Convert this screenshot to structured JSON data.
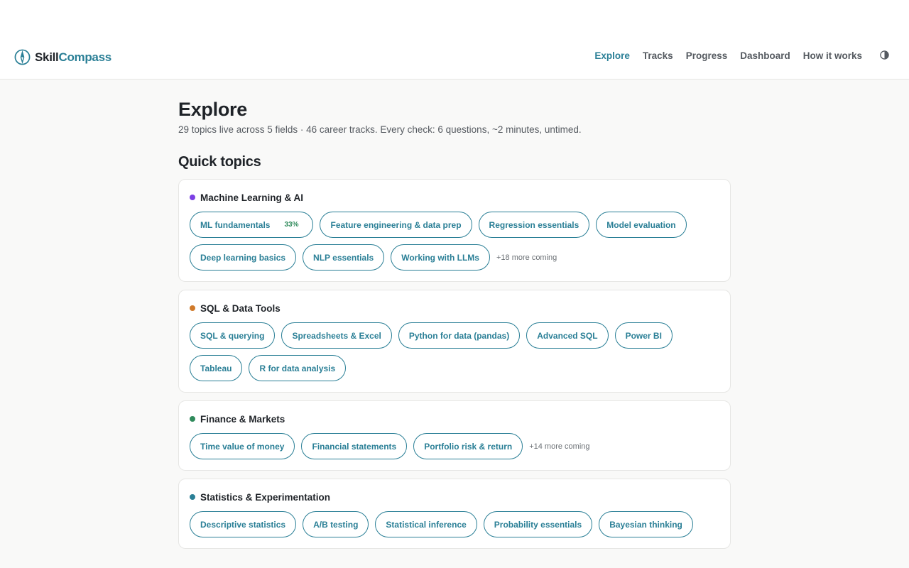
{
  "brand": {
    "name_a": "Skill",
    "name_b": "Compass"
  },
  "nav": {
    "items": [
      "Explore",
      "Tracks",
      "Progress",
      "Dashboard",
      "How it works"
    ]
  },
  "page": {
    "title": "Explore",
    "subtitle": "29 topics live across 5 fields · 46 career tracks. Every check: 6 questions, ~2 minutes, untimed.",
    "section_title": "Quick topics"
  },
  "fields": [
    {
      "name": "Machine Learning & AI",
      "color": "#7b3fe4",
      "topics": [
        "ML fundamentals",
        "Feature engineering & data prep",
        "Regression essentials",
        "Model evaluation",
        "Deep learning basics",
        "NLP essentials",
        "Working with LLMs"
      ],
      "progress": "33%",
      "more": "+18 more coming"
    },
    {
      "name": "SQL & Data Tools",
      "color": "#d07a2a",
      "topics": [
        "SQL & querying",
        "Spreadsheets & Excel",
        "Python for data (pandas)",
        "Advanced SQL",
        "Power BI",
        "Tableau",
        "R for data analysis"
      ],
      "more": ""
    },
    {
      "name": "Finance & Markets",
      "color": "#2f8a5b",
      "topics": [
        "Time value of money",
        "Financial statements",
        "Portfolio risk & return"
      ],
      "more": "+14 more coming"
    },
    {
      "name": "Statistics & Experimentation",
      "color": "#2a7f96",
      "topics": [
        "Descriptive statistics",
        "A/B testing",
        "Statistical inference",
        "Probability essentials",
        "Bayesian thinking"
      ],
      "more": ""
    }
  ]
}
